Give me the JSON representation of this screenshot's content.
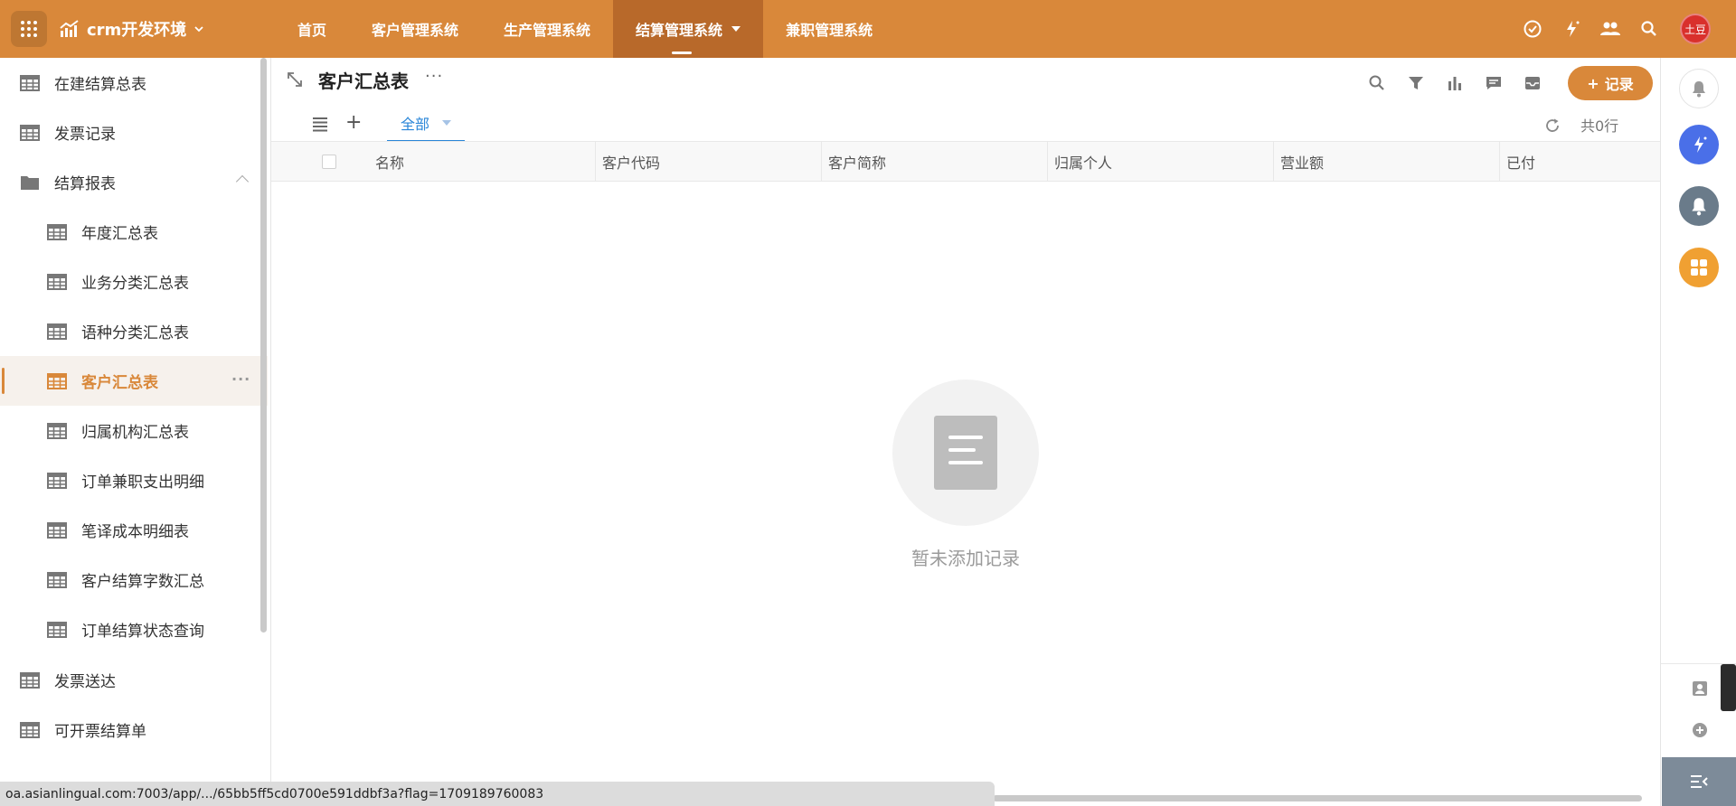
{
  "app": {
    "title": "crm开发环境"
  },
  "nav": {
    "items": [
      {
        "label": "首页",
        "active": false
      },
      {
        "label": "客户管理系统",
        "active": false
      },
      {
        "label": "生产管理系统",
        "active": false
      },
      {
        "label": "结算管理系统",
        "active": true
      },
      {
        "label": "兼职管理系统",
        "active": false
      }
    ]
  },
  "topbar": {
    "icons": [
      "check-circle-icon",
      "magic-wand-icon",
      "users-icon",
      "search-icon"
    ],
    "avatar_label": "土豆",
    "avatar_color": "#d9302c"
  },
  "colors": {
    "accent": "#d9883a",
    "active_nav": "#b8692a",
    "link": "#2a86d8"
  },
  "sidebar": {
    "items": [
      {
        "label": "在建结算总表",
        "icon": "table-icon",
        "level": 0
      },
      {
        "label": "发票记录",
        "icon": "table-icon",
        "level": 0
      },
      {
        "label": "结算报表",
        "icon": "folder-icon",
        "level": 0,
        "expanded": true
      },
      {
        "label": "年度汇总表",
        "icon": "table-icon",
        "level": 1
      },
      {
        "label": "业务分类汇总表",
        "icon": "table-icon",
        "level": 1
      },
      {
        "label": "语种分类汇总表",
        "icon": "table-icon",
        "level": 1
      },
      {
        "label": "客户汇总表",
        "icon": "table-icon",
        "level": 1,
        "active": true,
        "more": "···"
      },
      {
        "label": "归属机构汇总表",
        "icon": "table-icon",
        "level": 1
      },
      {
        "label": "订单兼职支出明细",
        "icon": "table-icon",
        "level": 1
      },
      {
        "label": "笔译成本明细表",
        "icon": "table-icon",
        "level": 1
      },
      {
        "label": "客户结算字数汇总",
        "icon": "table-icon",
        "level": 1
      },
      {
        "label": "订单结算状态查询",
        "icon": "table-icon",
        "level": 1
      },
      {
        "label": "发票送达",
        "icon": "table-icon",
        "level": 0
      },
      {
        "label": "可开票结算单",
        "icon": "table-icon",
        "level": 0
      }
    ]
  },
  "main": {
    "title": "客户汇总表",
    "title_more": "···",
    "toolbar_icons": [
      "search-icon",
      "filter-icon",
      "bar-chart-icon",
      "comment-icon",
      "inbox-icon"
    ],
    "add_button": "记录",
    "view_tab": "全部",
    "row_count": "共0行",
    "columns": [
      "名称",
      "客户代码",
      "客户简称",
      "归属个人",
      "营业额",
      "已付"
    ],
    "empty_text": "暂未添加记录"
  },
  "status_url": "oa.asianlingual.com:7003/app/.../65bb5ff5cd0700e591ddbf3a?flag=1709189760083"
}
